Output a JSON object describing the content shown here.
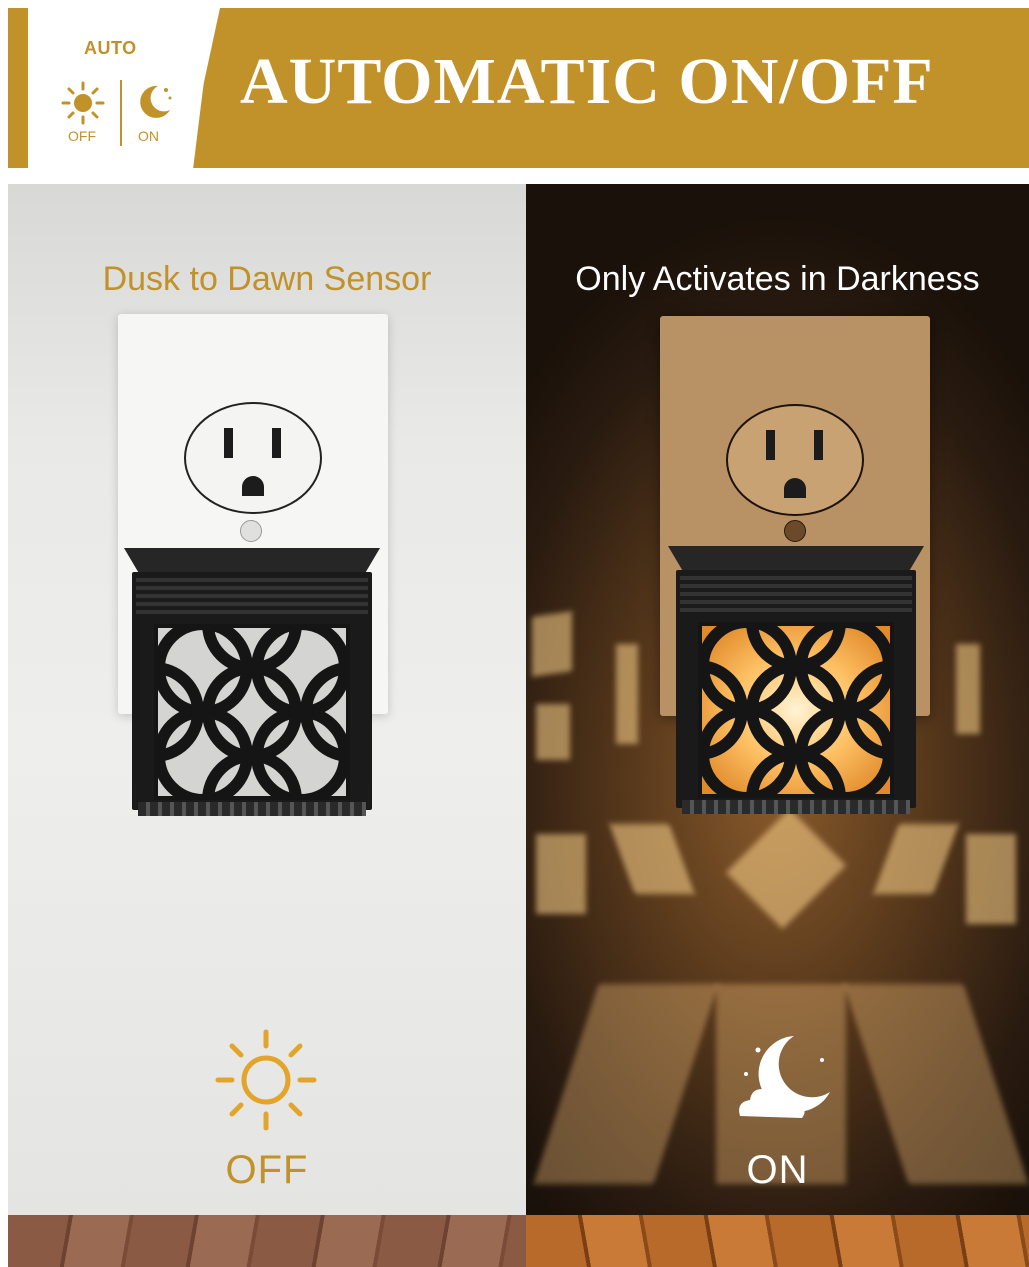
{
  "banner": {
    "badge_auto": "AUTO",
    "badge_off": "OFF",
    "badge_on": "ON",
    "title": "AUTOMATIC ON/OFF"
  },
  "left_panel": {
    "title": "Dusk to Dawn Sensor",
    "status_label": "OFF",
    "icon": "sun-icon"
  },
  "right_panel": {
    "title": "Only Activates in Darkness",
    "status_label": "ON",
    "icon": "moon-cloud-icon"
  },
  "colors": {
    "gold": "#c2922a",
    "white": "#ffffff",
    "dark": "#1a1a1a"
  }
}
